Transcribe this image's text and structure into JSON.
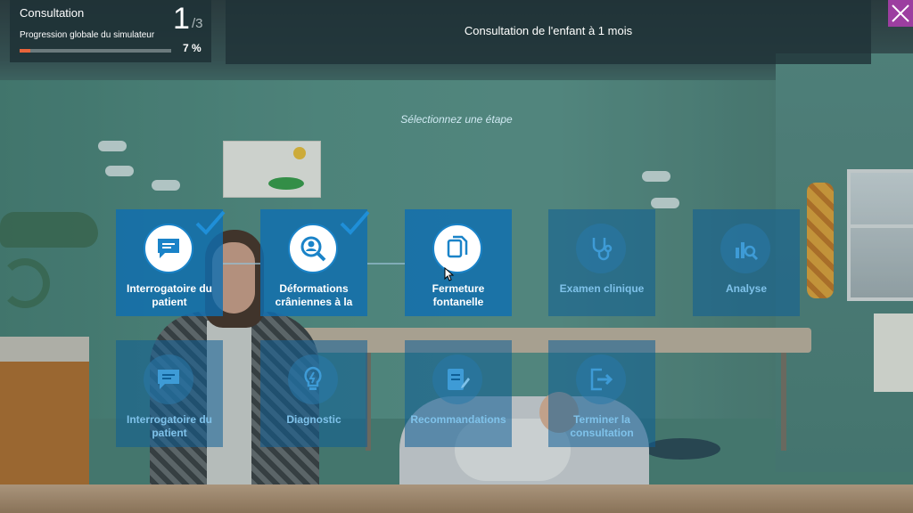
{
  "progress": {
    "title": "Consultation",
    "step_current": "1",
    "step_total": "/3",
    "label": "Progression globale du simulateur",
    "percent_text": "7 %",
    "percent_value": 0.07
  },
  "header": {
    "title": "Consultation de l'enfant à 1 mois"
  },
  "prompt": "Sélectionnez une étape",
  "steps_row1": [
    {
      "label": "Interrogatoire du patient",
      "icon": "chat-bubble-icon",
      "state": "completed"
    },
    {
      "label": "Déformations crâniennes à la",
      "icon": "magnify-person-icon",
      "state": "completed"
    },
    {
      "label": "Fermeture fontanelle",
      "icon": "documents-icon",
      "state": "available"
    },
    {
      "label": "Examen clinique",
      "icon": "stethoscope-icon",
      "state": "locked"
    },
    {
      "label": "Analyse",
      "icon": "chart-search-icon",
      "state": "locked"
    }
  ],
  "steps_row2": [
    {
      "label": "Interrogatoire du patient",
      "icon": "chat-bubble-icon",
      "state": "locked"
    },
    {
      "label": "Diagnostic",
      "icon": "lightbulb-icon",
      "state": "locked"
    },
    {
      "label": "Recommandations",
      "icon": "document-edit-icon",
      "state": "locked"
    },
    {
      "label": "Terminer la consultation",
      "icon": "exit-icon",
      "state": "locked"
    }
  ],
  "colors": {
    "tile_active": "#0e6eb2",
    "progress_fill": "#e8643b",
    "close_button": "#9c3ea0"
  }
}
